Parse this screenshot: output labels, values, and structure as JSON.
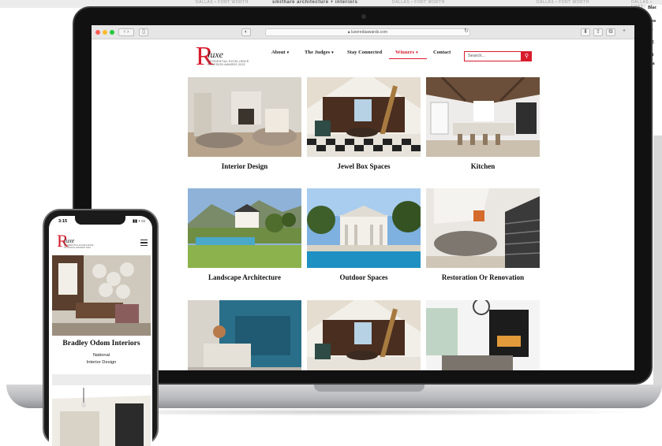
{
  "background": {
    "top_texts": [
      "DALLAS • FORT WORTH",
      "smithare architecture + interiors",
      "DALLAS • FORT WORTH",
      "DALLAS • FORT WORTH",
      "DALLAS • FORT WORTH"
    ],
    "right_texts": [
      "Blac",
      "ains",
      "To",
      "Gg",
      "sot",
      "ara",
      "r I"
    ]
  },
  "browser": {
    "url": "luxeredaawards.com"
  },
  "site": {
    "logo": {
      "letter": "R",
      "word": "luxe",
      "sub1": "RESIDENTIAL EXCELLENCE",
      "sub2": "IN DESIGN AWARDS 2022"
    },
    "nav": [
      {
        "label": "About",
        "caret": "▾"
      },
      {
        "label": "The Judges",
        "caret": "▾"
      },
      {
        "label": "Stay Connected"
      },
      {
        "label": "Winners",
        "caret": "▾",
        "active": true
      },
      {
        "label": "Contact"
      }
    ],
    "search": {
      "placeholder": "Search...",
      "icon": "search-icon"
    },
    "accent": "#d71c2c"
  },
  "categories": [
    {
      "label": "Interior Design"
    },
    {
      "label": "Jewel Box Spaces"
    },
    {
      "label": "Kitchen"
    },
    {
      "label": "Landscape Architecture"
    },
    {
      "label": "Outdoor Spaces"
    },
    {
      "label": "Restoration Or Renovation"
    },
    {
      "label": ""
    },
    {
      "label": ""
    },
    {
      "label": ""
    }
  ],
  "phone": {
    "time": "3:15",
    "status": "▮▮ • ▭",
    "winner": "Bradley Odom Interiors",
    "level": "National",
    "category": "Interior Design"
  }
}
